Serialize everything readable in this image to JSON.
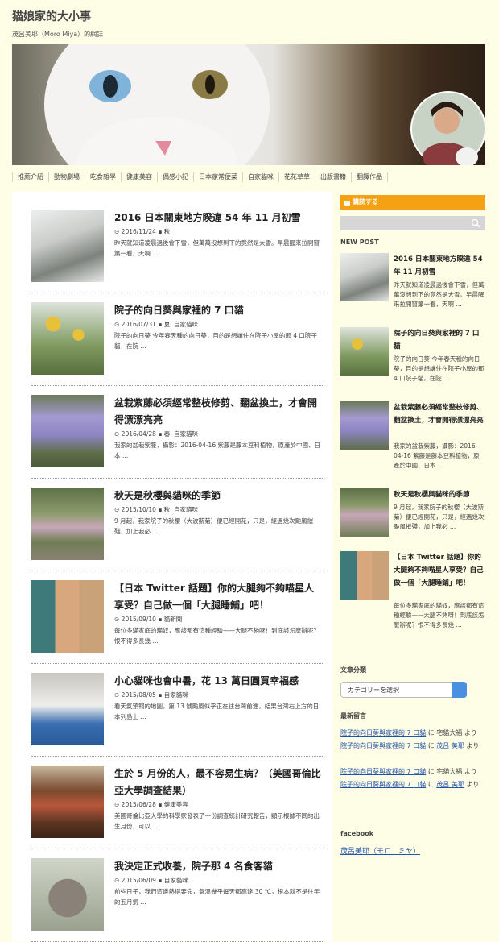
{
  "site": {
    "title": "猫娘家的大小事",
    "description": "茂呂美耶（Moro Miya）的網誌"
  },
  "nav": [
    "推薦介紹",
    "動物劇場",
    "吃食雜學",
    "健康美容",
    "偶感小記",
    "日本家常便菜",
    "自家貓咪",
    "花花草草",
    "出版書籍",
    "翻譯作品"
  ],
  "posts": [
    {
      "title": "2016 日本關東地方睽違 54 年 11 月初雪",
      "date": "2016/11/24",
      "cats": "秋",
      "excerpt": "昨天就知道凌晨過後會下雪，但萬萬沒想到下的竟然是大雪。早晨醒來拉開窗簾一看，天啊 …"
    },
    {
      "title": "院子的向日葵與家裡的 7 口貓",
      "date": "2016/07/31",
      "cats": "夏, 自家貓咪",
      "excerpt": "院子的向日葵 今年春天種的向日葵，目的是想讓住在院子小屋的那 4 口院子貓，在院 …"
    },
    {
      "title": "盆栽紫藤必須經常整枝修剪、翻盆換土，才會開得漂漂亮亮",
      "date": "2016/04/28",
      "cats": "春, 自家貓咪",
      "excerpt": "我家的盆栽紫藤，攝影：2016-04-16 紫藤是藤本豆科植物，原產於中國、日本 …"
    },
    {
      "title": "秋天是秋櫻與貓咪的季節",
      "date": "2015/10/10",
      "cats": "秋, 自家貓咪",
      "excerpt": "9 月起，我家院子的秋櫻（大波斯菊）便已經開花，只是，經過幾次颱風摧殘，加上我必 …"
    },
    {
      "title": "【日本 Twitter 話題】你的大腿夠不夠喵星人享受？自己做一個「大腿睡鋪」吧！",
      "date": "2015/09/10",
      "cats": "貓新聞",
      "excerpt": "每位多貓家庭的貓奴，應該都有這種經驗——大腿不夠呀！到底該怎麼辦呢？恨不得多長幾 …"
    },
    {
      "title": "小心貓咪也會中暑，花 13 萬日圓買幸福感",
      "date": "2015/08/05",
      "cats": "自家貓咪",
      "excerpt": "看天氣預報的地圖，第 13 號颱風似乎正在往台灣前進，結果台灣右上方的日本列島上 …"
    },
    {
      "title": "生於 5 月份的人，最不容易生病？（美國哥倫比亞大學調查結果）",
      "date": "2015/06/28",
      "cats": "健康美容",
      "excerpt": "美國哥倫比亞大學的科學家發表了一份調查統計研究報告，顯示根據不同的出生月份，可以 …"
    },
    {
      "title": "我決定正式收養，院子那 4 名食客貓",
      "date": "2015/06/09",
      "cats": "自家貓咪",
      "excerpt": "前些日子，我們這邊熱得要命，氣溫幾乎每天都高達 30 ℃，根本就不是往年的五月氣 …"
    }
  ],
  "sidebar": {
    "subscribe": "購読する",
    "new_post_heading": "NEW POST",
    "new_posts": [
      {
        "title": "2016 日本關東地方睽違 54 年 11 月初雪",
        "excerpt": "昨天就知道凌晨過後會下雪，但萬萬沒想到下的竟然是大雪。早晨醒來拉開窗簾一看，天啊 …"
      },
      {
        "title": "院子的向日葵與家裡的 7 口貓",
        "excerpt": "院子的向日葵 今年春天種的向日葵，目的是想讓住在院子小屋的那 4 口院子貓，在院 …"
      },
      {
        "title": "盆栽紫藤必須經常整枝修剪、翻盆換土，才會開得漂漂亮亮",
        "excerpt": "我家的盆栽紫藤，攝影：2016-04-16 紫藤是藤本豆科植物，原產於中國、日本 …"
      },
      {
        "title": "秋天是秋櫻與貓咪的季節",
        "excerpt": "9 月起，我家院子的秋櫻（大波斯菊）便已經開花，只是，經過幾次颱風摧殘，加上我必 …"
      },
      {
        "title": "【日本 Twitter 話題】你的大腿夠不夠喵星人享受？自己做一個「大腿睡鋪」吧！",
        "excerpt": "每位多貓家庭的貓奴，應該都有這種經驗——大腿不夠呀！到底該怎麼辦呢？恨不得多長幾 …"
      }
    ],
    "categories_heading": "文章分類",
    "categories_select": "カテゴリーを選択",
    "recent_comments_heading": "最新留言",
    "comments": [
      {
        "post": "院子的向日葵與家裡的 7 口貓",
        "sep": " に ",
        "author": "宅貓大福",
        "tail": " より"
      },
      {
        "post": "院子的向日葵與家裡的 7 口貓",
        "sep": " に ",
        "author": "茂呂 美耶",
        "tail": " より"
      },
      {
        "post": "院子的向日葵與家裡的 7 口貓",
        "sep": " に ",
        "author": "宅貓大福",
        "tail": " より"
      },
      {
        "post": "院子的向日葵與家裡的 7 口貓",
        "sep": " に ",
        "author": "茂呂 美耶",
        "tail": " より"
      }
    ],
    "facebook_heading": "facebook",
    "facebook_link": "茂呂美耶（モロ　ミヤ）"
  }
}
